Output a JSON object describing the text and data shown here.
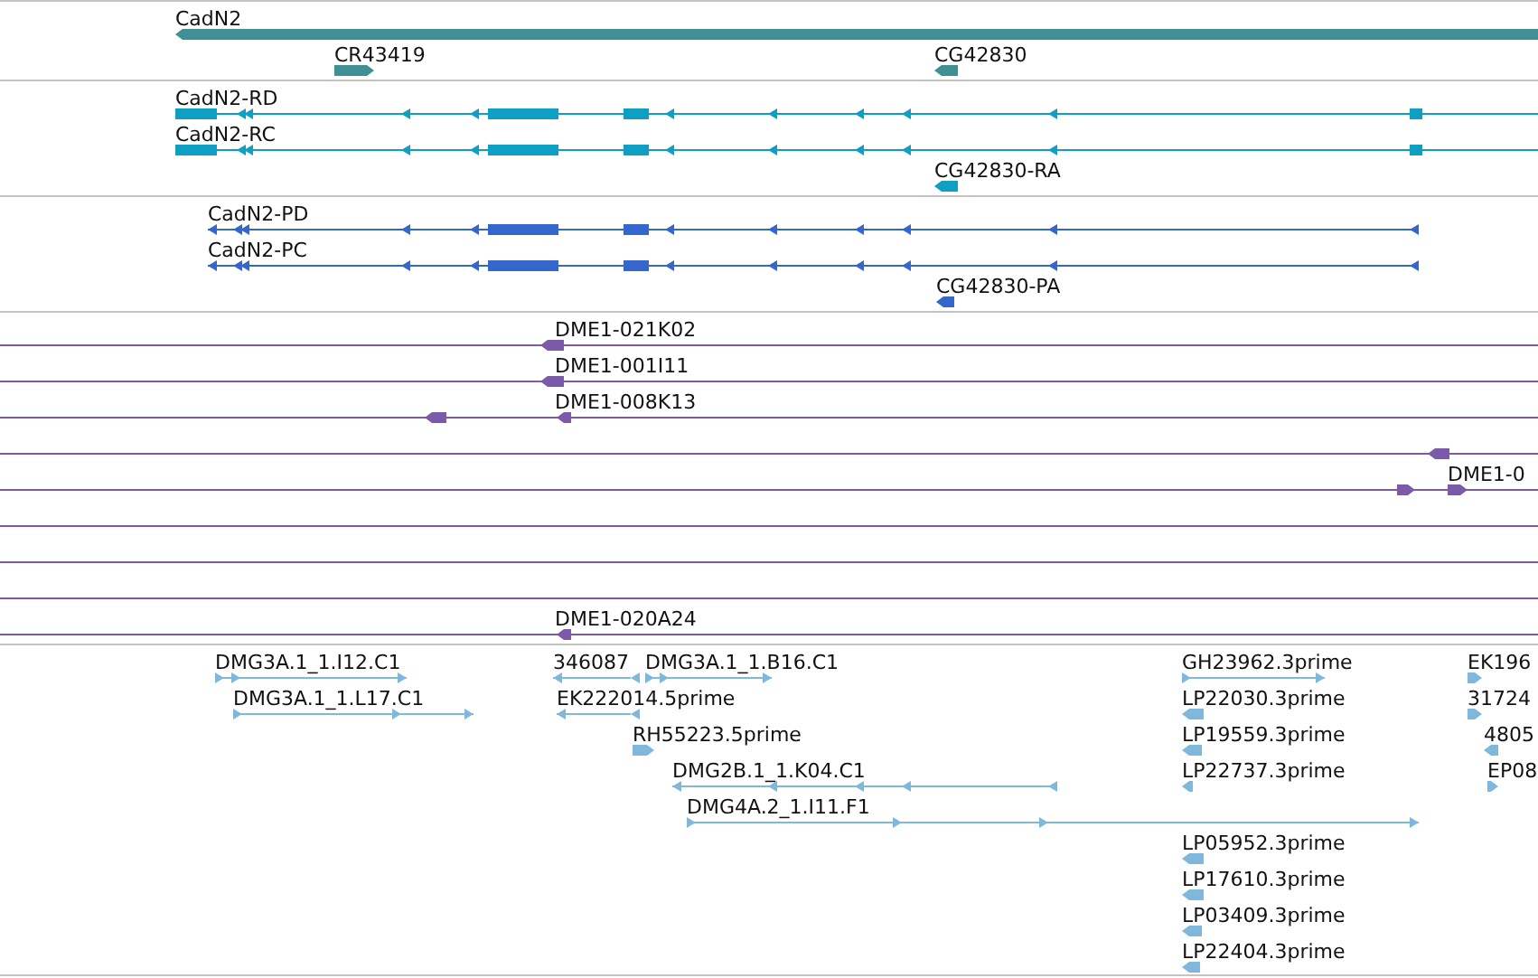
{
  "tracks": [
    {
      "kind": "gene",
      "features": [
        {
          "label": "CadN2",
          "reverse": true
        },
        {
          "label": "CR43419",
          "reverse": false
        },
        {
          "label": "CG42830",
          "reverse": true
        }
      ]
    },
    {
      "kind": "transcript",
      "features": [
        {
          "label": "CadN2-RD",
          "reverse": true
        },
        {
          "label": "CadN2-RC",
          "reverse": true
        },
        {
          "label": "CG42830-RA",
          "reverse": true
        }
      ]
    },
    {
      "kind": "protein",
      "features": [
        {
          "label": "CadN2-PD",
          "reverse": true
        },
        {
          "label": "CadN2-PC",
          "reverse": true
        },
        {
          "label": "CG42830-PA",
          "reverse": true
        }
      ]
    },
    {
      "kind": "clone",
      "features": [
        {
          "label": "DME1-021K02",
          "reverse": true
        },
        {
          "label": "DME1-001I11",
          "reverse": true
        },
        {
          "reverse": true
        },
        {
          "label": "DME1-008K13",
          "reverse": true
        },
        {
          "reverse": true
        },
        {
          "reverse": false
        },
        {
          "label": "DME1-0",
          "reverse": false
        },
        {
          "label": "DME1-020A24",
          "reverse": true
        }
      ]
    },
    {
      "kind": "est",
      "features": [
        {
          "label": "DMG3A.1_1.I12.C1",
          "reverse": false
        },
        {
          "label": "DMG3A.1_1.L17.C1",
          "reverse": false
        },
        {
          "label": "346087",
          "reverse": true
        },
        {
          "label": "DMG3A.1_1.B16.C1",
          "reverse": false
        },
        {
          "label": "EK222014.5prime",
          "reverse": true
        },
        {
          "label": "RH55223.5prime",
          "reverse": false
        },
        {
          "label": "DMG2B.1_1.K04.C1",
          "reverse": true
        },
        {
          "label": "DMG4A.2_1.I11.F1",
          "reverse": false
        },
        {
          "label": "GH23962.3prime",
          "reverse": false
        },
        {
          "label": "LP22030.3prime",
          "reverse": true
        },
        {
          "label": "LP19559.3prime",
          "reverse": true
        },
        {
          "label": "LP22737.3prime",
          "reverse": true
        },
        {
          "label": "LP05952.3prime",
          "reverse": true
        },
        {
          "label": "LP17610.3prime",
          "reverse": true
        },
        {
          "label": "LP03409.3prime",
          "reverse": true
        },
        {
          "label": "LP22404.3prime",
          "reverse": true
        },
        {
          "label": "EK196",
          "reverse": false
        },
        {
          "label": "31724",
          "reverse": false
        },
        {
          "label": "4805",
          "reverse": true
        },
        {
          "label": "EP08",
          "reverse": false
        }
      ]
    }
  ]
}
